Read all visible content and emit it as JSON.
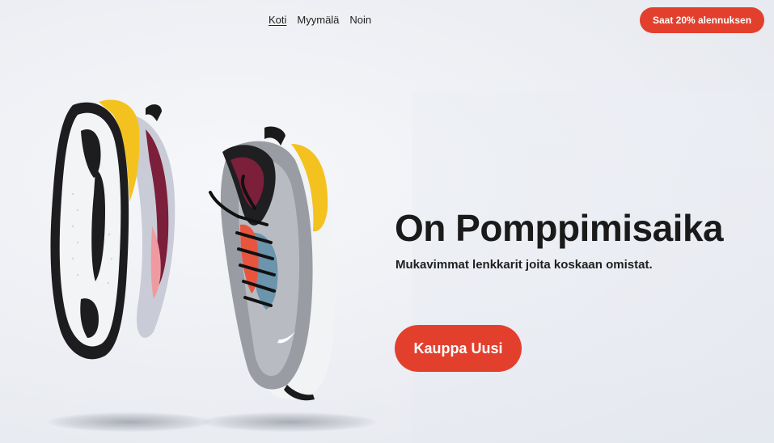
{
  "nav": {
    "items": [
      {
        "label": "Koti",
        "active": true
      },
      {
        "label": "Myymälä",
        "active": false
      },
      {
        "label": "Noin",
        "active": false
      }
    ]
  },
  "promo": {
    "label": "Saat 20% alennuksen"
  },
  "hero": {
    "title": "On Pomppimisaika",
    "subtitle": "Mukavimmat lenkkarit joita koskaan omistat.",
    "cta_label": "Kauppa Uusi"
  },
  "colors": {
    "accent": "#e2402d",
    "text": "#1a1a1a",
    "background": "#eceef3"
  },
  "image": {
    "subject": "sneakers-pair-icon"
  }
}
